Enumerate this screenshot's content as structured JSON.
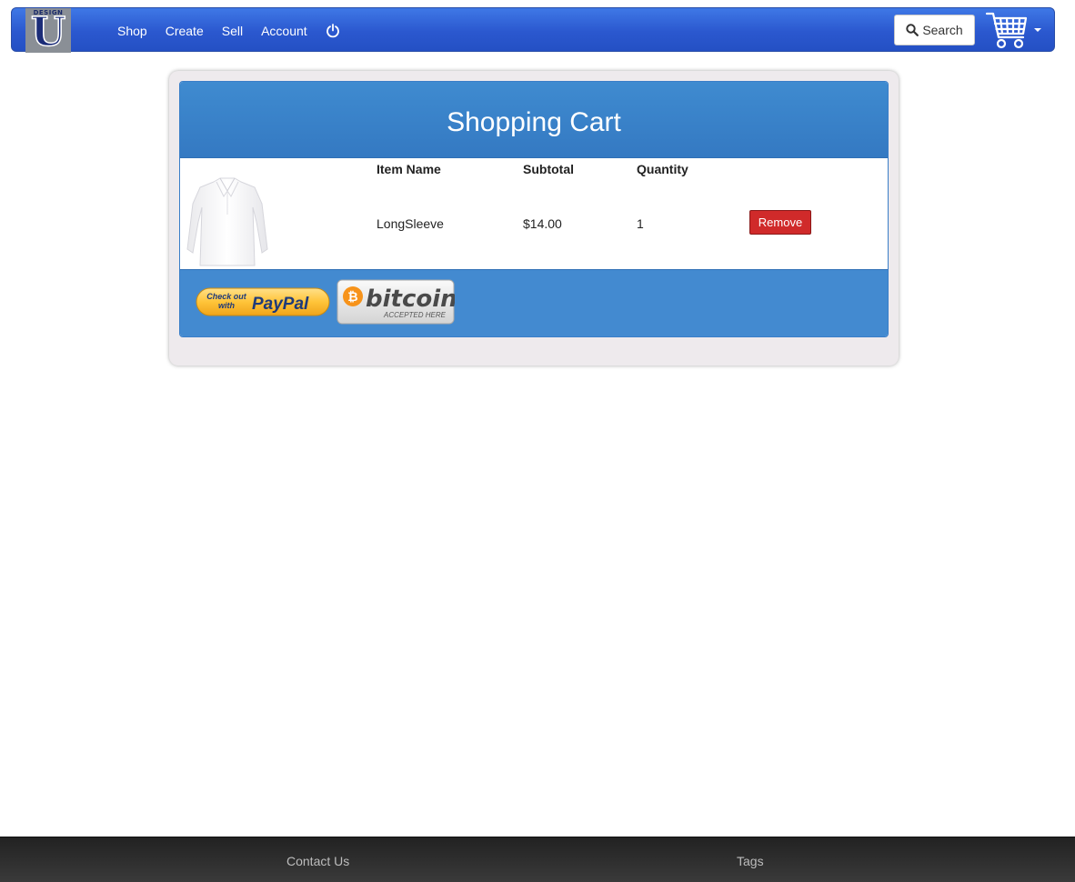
{
  "navbar": {
    "logo_small_text": "DESIGN",
    "logo_letter": "U",
    "links": [
      "Shop",
      "Create",
      "Sell",
      "Account"
    ],
    "search_label": "Search",
    "brand_color": "#2b58cf"
  },
  "cart": {
    "title": "Shopping Cart",
    "columns": {
      "item_name": "Item Name",
      "subtotal": "Subtotal",
      "quantity": "Quantity"
    },
    "items": [
      {
        "name": "LongSleeve",
        "subtotal": "$14.00",
        "quantity": "1",
        "remove_label": "Remove",
        "image": "white-long-sleeve-shirt"
      }
    ],
    "paypal": {
      "line1": "Check out",
      "line2": "with",
      "brand": "PayPal"
    },
    "bitcoin": {
      "brand": "bitcoin",
      "tagline": "ACCEPTED HERE"
    },
    "header_color": "#3a84cc",
    "remove_color": "#d02a2a"
  },
  "footer": {
    "links": [
      "Contact Us",
      "Tags"
    ]
  }
}
